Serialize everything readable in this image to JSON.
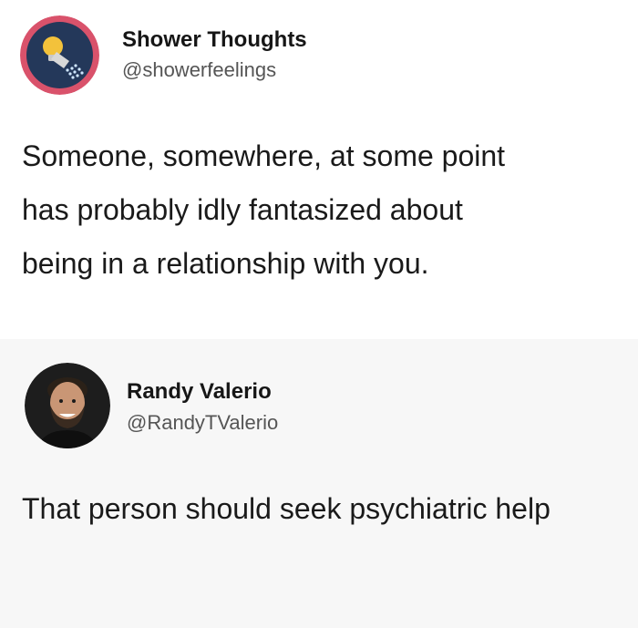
{
  "tweets": [
    {
      "name": "Shower Thoughts",
      "handle": "@showerfeelings",
      "text": "Someone, somewhere, at some point has probably idly fantasized about being in a relationship with you.",
      "avatar_icon": "shower-head-lightbulb-icon"
    },
    {
      "name": "Randy Valerio",
      "handle": "@RandyTValerio",
      "text": "That person should seek psychiatric help",
      "avatar_icon": "user-photo"
    }
  ],
  "colors": {
    "avatar_ring": "#d9526b",
    "avatar_bg": "#24385a",
    "bulb": "#f3c23b",
    "text": "#1a1a1a",
    "muted": "#555555"
  }
}
